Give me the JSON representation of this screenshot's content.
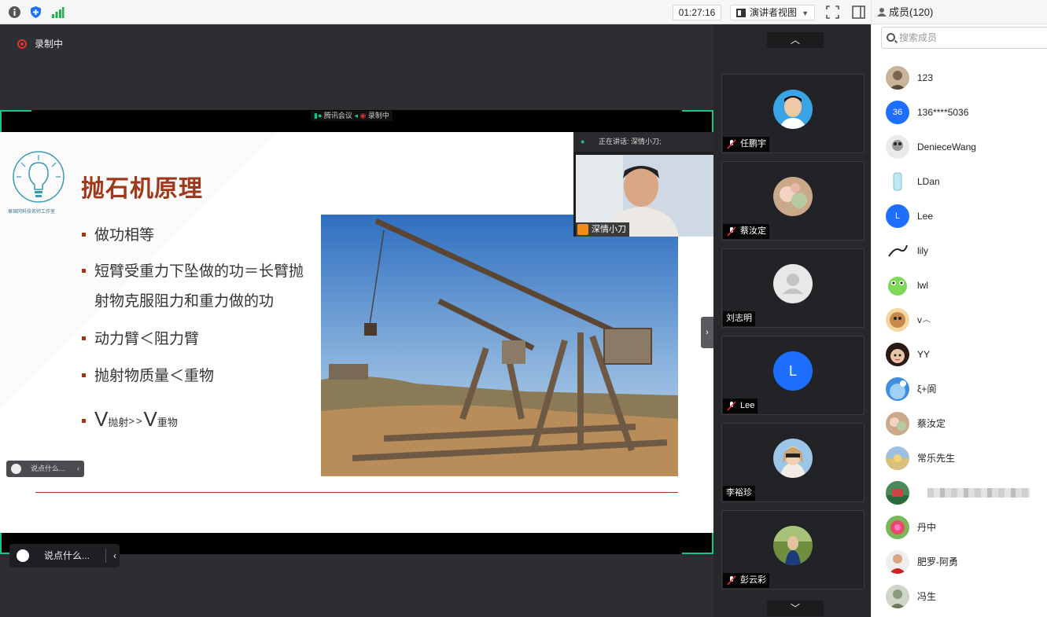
{
  "top_bar": {
    "timer": "01:27:16",
    "view_label": "演讲者视图"
  },
  "recording": {
    "label": "录制中"
  },
  "share": {
    "top_strip": "腾讯会议",
    "top_strip_rec": "录制中"
  },
  "slide": {
    "title": "抛石机原理",
    "logo_text": "章锦冈科技名师工作室",
    "bullets": [
      {
        "text": "做功相等"
      },
      {
        "text": "短臂受重力下坠做的功＝长臂抛",
        "cont": "射物克服阻力和重力做的功"
      },
      {
        "text": "动力臂＜阻力臂"
      },
      {
        "text": "抛射物质量＜重物"
      }
    ],
    "formula": {
      "v1": "V",
      "sub1": "抛射",
      "op": ">>",
      "v2": "V",
      "sub2": "重物"
    }
  },
  "speaker": {
    "header": "正在讲话: 深情小刀;",
    "name": "深情小刀"
  },
  "chat": {
    "placeholder": "说点什么...",
    "placeholder_small": "说点什么..."
  },
  "gallery": {
    "tiles": [
      {
        "name": "任鹏宇",
        "muted": true,
        "avatar": "photo-man"
      },
      {
        "name": "蔡汝定",
        "muted": true,
        "avatar": "photo-flower"
      },
      {
        "name": "刘志明",
        "muted": false,
        "avatar": "default-user"
      },
      {
        "name": "Lee",
        "muted": true,
        "avatar": "letter",
        "letter": "L"
      },
      {
        "name": "李裕珍",
        "muted": false,
        "avatar": "photo-woman"
      },
      {
        "name": "彭云彩",
        "muted": true,
        "avatar": "photo-woman2"
      }
    ]
  },
  "members": {
    "header": "成员(120)",
    "search_placeholder": "搜索成员",
    "list": [
      {
        "name": "123",
        "avatar": "photo"
      },
      {
        "name": "136****5036",
        "avatar": "badge",
        "badge": "36",
        "color": "#1e6fff"
      },
      {
        "name": "DenieceWang",
        "avatar": "photo"
      },
      {
        "name": "LDan",
        "avatar": "photo"
      },
      {
        "name": "Lee",
        "avatar": "badge",
        "badge": "L",
        "color": "#1e6fff"
      },
      {
        "name": "lily",
        "avatar": "photo"
      },
      {
        "name": "lwl",
        "avatar": "photo"
      },
      {
        "name": "v෴",
        "avatar": "photo"
      },
      {
        "name": "YY",
        "avatar": "photo"
      },
      {
        "name": "ξ+阆",
        "avatar": "photo"
      },
      {
        "name": "蔡汝定",
        "avatar": "photo"
      },
      {
        "name": "常乐先生",
        "avatar": "photo"
      },
      {
        "name": "",
        "avatar": "photo",
        "blurred": true
      },
      {
        "name": "丹中",
        "avatar": "photo"
      },
      {
        "name": "肥罗-阿勇",
        "avatar": "photo"
      },
      {
        "name": "冯生",
        "avatar": "photo"
      }
    ]
  },
  "colors": {
    "accent_green": "#16c784",
    "title_red": "#a0391c",
    "brand_blue": "#1e6fff"
  }
}
